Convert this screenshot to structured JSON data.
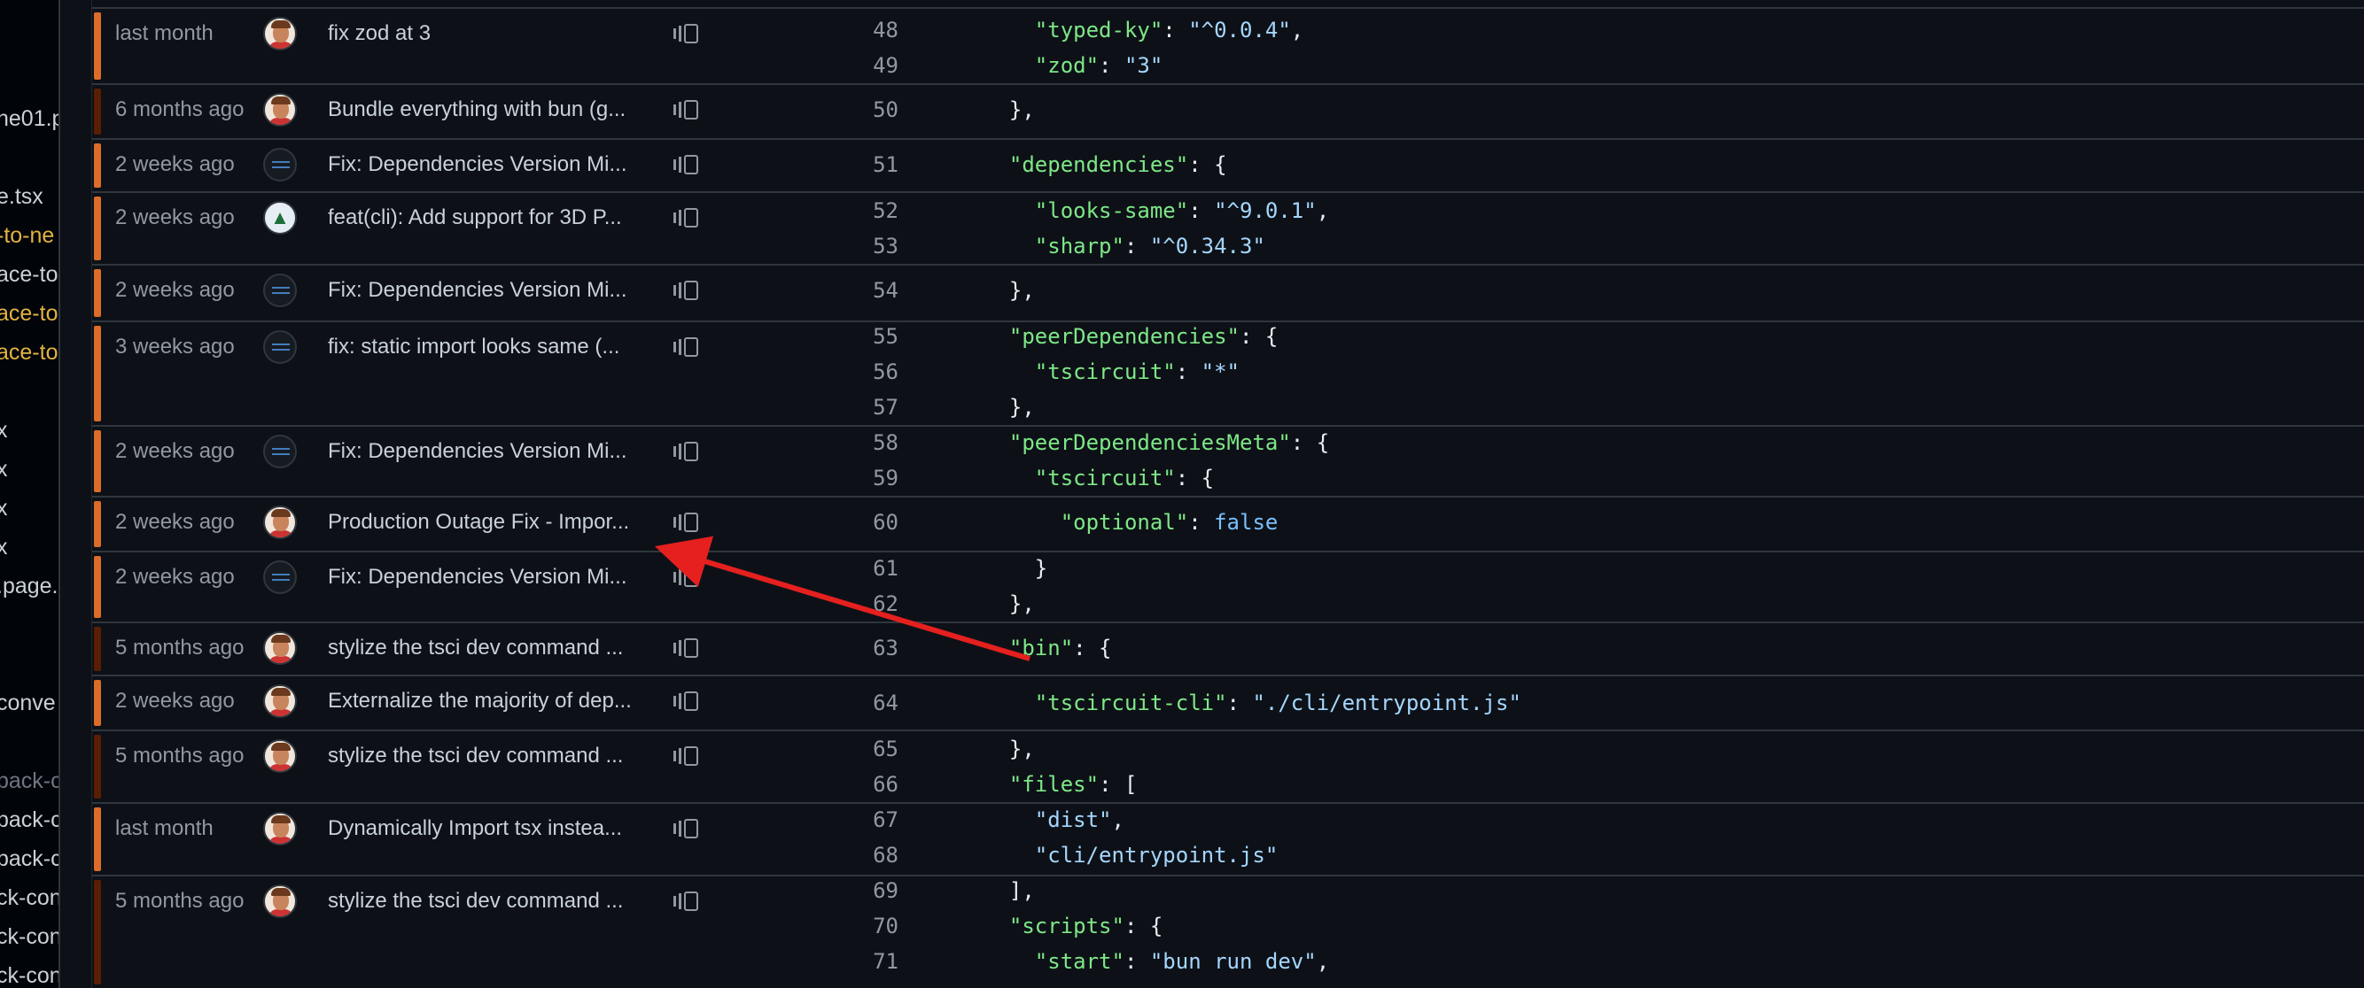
{
  "sidebar": {
    "items": [
      {
        "label": "he01.p",
        "style": "normal"
      },
      {
        "label": "e.tsx",
        "style": "normal"
      },
      {
        "label": "-to-ne",
        "style": "yellow"
      },
      {
        "label": "ace-to",
        "style": "normal"
      },
      {
        "label": "ace-to",
        "style": "yellow"
      },
      {
        "label": "ace-to",
        "style": "yellow"
      },
      {
        "label": "x",
        "style": "normal"
      },
      {
        "label": "x",
        "style": "normal"
      },
      {
        "label": "x",
        "style": "normal"
      },
      {
        "label": "x",
        "style": "normal"
      },
      {
        "label": ".page.",
        "style": "normal"
      },
      {
        "label": "conve",
        "style": "normal"
      },
      {
        "label": "pack-c",
        "style": "dim"
      },
      {
        "label": "pack-c",
        "style": "normal"
      },
      {
        "label": "pack-c",
        "style": "normal"
      },
      {
        "label": "ck-con",
        "style": "normal"
      },
      {
        "label": "ck-con",
        "style": "normal"
      },
      {
        "label": "ck-con",
        "style": "normal"
      }
    ]
  },
  "blame": {
    "hunks": [
      {
        "time": "last month",
        "avatar": "person",
        "message": "fix zod at 3",
        "recent": true,
        "lines": [
          {
            "num": "48",
            "indent": "    ",
            "tokens": [
              {
                "t": "\"typed-ky\"",
                "c": "k"
              },
              {
                "t": ": ",
                "c": ""
              },
              {
                "t": "\"^0.0.4\"",
                "c": "s"
              },
              {
                "t": ",",
                "c": ""
              }
            ]
          },
          {
            "num": "49",
            "indent": "    ",
            "tokens": [
              {
                "t": "\"zod\"",
                "c": "k"
              },
              {
                "t": ": ",
                "c": ""
              },
              {
                "t": "\"3\"",
                "c": "s"
              }
            ]
          }
        ]
      },
      {
        "time": "6 months ago",
        "avatar": "person",
        "message": "Bundle everything with bun (g...",
        "recent": false,
        "lines": [
          {
            "num": "50",
            "indent": "  ",
            "tokens": [
              {
                "t": "},",
                "c": ""
              }
            ]
          }
        ]
      },
      {
        "time": "2 weeks ago",
        "avatar": "app",
        "message": "Fix: Dependencies Version Mi...",
        "recent": true,
        "lines": [
          {
            "num": "51",
            "indent": "  ",
            "tokens": [
              {
                "t": "\"dependencies\"",
                "c": "k"
              },
              {
                "t": ": {",
                "c": ""
              }
            ]
          }
        ]
      },
      {
        "time": "2 weeks ago",
        "avatar": "tree",
        "message": "feat(cli): Add support for 3D P...",
        "recent": true,
        "lines": [
          {
            "num": "52",
            "indent": "    ",
            "tokens": [
              {
                "t": "\"looks-same\"",
                "c": "k"
              },
              {
                "t": ": ",
                "c": ""
              },
              {
                "t": "\"^9.0.1\"",
                "c": "s"
              },
              {
                "t": ",",
                "c": ""
              }
            ]
          },
          {
            "num": "53",
            "indent": "    ",
            "tokens": [
              {
                "t": "\"sharp\"",
                "c": "k"
              },
              {
                "t": ": ",
                "c": ""
              },
              {
                "t": "\"^0.34.3\"",
                "c": "s"
              }
            ]
          }
        ]
      },
      {
        "time": "2 weeks ago",
        "avatar": "app",
        "message": "Fix: Dependencies Version Mi...",
        "recent": true,
        "lines": [
          {
            "num": "54",
            "indent": "  ",
            "tokens": [
              {
                "t": "},",
                "c": ""
              }
            ]
          }
        ]
      },
      {
        "time": "3 weeks ago",
        "avatar": "app",
        "message": "fix: static import looks same (...",
        "recent": true,
        "lines": [
          {
            "num": "55",
            "indent": "  ",
            "tokens": [
              {
                "t": "\"peerDependencies\"",
                "c": "k"
              },
              {
                "t": ": {",
                "c": ""
              }
            ]
          },
          {
            "num": "56",
            "indent": "    ",
            "tokens": [
              {
                "t": "\"tscircuit\"",
                "c": "k"
              },
              {
                "t": ": ",
                "c": ""
              },
              {
                "t": "\"*\"",
                "c": "s"
              }
            ]
          },
          {
            "num": "57",
            "indent": "  ",
            "tokens": [
              {
                "t": "},",
                "c": ""
              }
            ]
          }
        ]
      },
      {
        "time": "2 weeks ago",
        "avatar": "app",
        "message": "Fix: Dependencies Version Mi...",
        "recent": true,
        "lines": [
          {
            "num": "58",
            "indent": "  ",
            "tokens": [
              {
                "t": "\"peerDependenciesMeta\"",
                "c": "k"
              },
              {
                "t": ": {",
                "c": ""
              }
            ]
          },
          {
            "num": "59",
            "indent": "    ",
            "tokens": [
              {
                "t": "\"tscircuit\"",
                "c": "k"
              },
              {
                "t": ": {",
                "c": ""
              }
            ]
          }
        ]
      },
      {
        "time": "2 weeks ago",
        "avatar": "person",
        "message": "Production Outage Fix - Impor...",
        "recent": true,
        "lines": [
          {
            "num": "60",
            "indent": "      ",
            "tokens": [
              {
                "t": "\"optional\"",
                "c": "k"
              },
              {
                "t": ": ",
                "c": ""
              },
              {
                "t": "false",
                "c": "c"
              }
            ]
          }
        ]
      },
      {
        "time": "2 weeks ago",
        "avatar": "app",
        "message": "Fix: Dependencies Version Mi...",
        "recent": true,
        "lines": [
          {
            "num": "61",
            "indent": "    ",
            "tokens": [
              {
                "t": "}",
                "c": ""
              }
            ]
          },
          {
            "num": "62",
            "indent": "  ",
            "tokens": [
              {
                "t": "},",
                "c": ""
              }
            ]
          }
        ]
      },
      {
        "time": "5 months ago",
        "avatar": "person",
        "message": "stylize the tsci dev command ...",
        "recent": false,
        "lines": [
          {
            "num": "63",
            "indent": "  ",
            "tokens": [
              {
                "t": "\"bin\"",
                "c": "k"
              },
              {
                "t": ": {",
                "c": ""
              }
            ]
          }
        ]
      },
      {
        "time": "2 weeks ago",
        "avatar": "person",
        "message": "Externalize the majority of dep...",
        "recent": true,
        "lines": [
          {
            "num": "64",
            "indent": "    ",
            "tokens": [
              {
                "t": "\"tscircuit-cli\"",
                "c": "k"
              },
              {
                "t": ": ",
                "c": ""
              },
              {
                "t": "\"./cli/entrypoint.js\"",
                "c": "s"
              }
            ]
          }
        ]
      },
      {
        "time": "5 months ago",
        "avatar": "person",
        "message": "stylize the tsci dev command ...",
        "recent": false,
        "lines": [
          {
            "num": "65",
            "indent": "  ",
            "tokens": [
              {
                "t": "},",
                "c": ""
              }
            ]
          },
          {
            "num": "66",
            "indent": "  ",
            "tokens": [
              {
                "t": "\"files\"",
                "c": "k"
              },
              {
                "t": ": [",
                "c": ""
              }
            ]
          }
        ]
      },
      {
        "time": "last month",
        "avatar": "person",
        "message": "Dynamically Import tsx instea...",
        "recent": true,
        "lines": [
          {
            "num": "67",
            "indent": "    ",
            "tokens": [
              {
                "t": "\"dist\"",
                "c": "s"
              },
              {
                "t": ",",
                "c": ""
              }
            ]
          },
          {
            "num": "68",
            "indent": "    ",
            "tokens": [
              {
                "t": "\"cli/entrypoint.js\"",
                "c": "s"
              }
            ]
          }
        ]
      },
      {
        "time": "5 months ago",
        "avatar": "person",
        "message": "stylize the tsci dev command ...",
        "recent": false,
        "lines": [
          {
            "num": "69",
            "indent": "  ",
            "tokens": [
              {
                "t": "],",
                "c": ""
              }
            ]
          },
          {
            "num": "70",
            "indent": "  ",
            "tokens": [
              {
                "t": "\"scripts\"",
                "c": "k"
              },
              {
                "t": ": {",
                "c": ""
              }
            ]
          },
          {
            "num": "71",
            "indent": "    ",
            "tokens": [
              {
                "t": "\"start\"",
                "c": "k"
              },
              {
                "t": ": ",
                "c": ""
              },
              {
                "t": "\"bun run dev\"",
                "c": "s"
              },
              {
                "t": ",",
                "c": ""
              }
            ]
          }
        ]
      }
    ]
  },
  "annotation": {
    "color": "#e5201f"
  },
  "colors": {
    "recent": "#db6d28",
    "old": "#5a1e02",
    "key": "#7ee787",
    "string": "#a5d6ff",
    "constant": "#79c0ff"
  }
}
